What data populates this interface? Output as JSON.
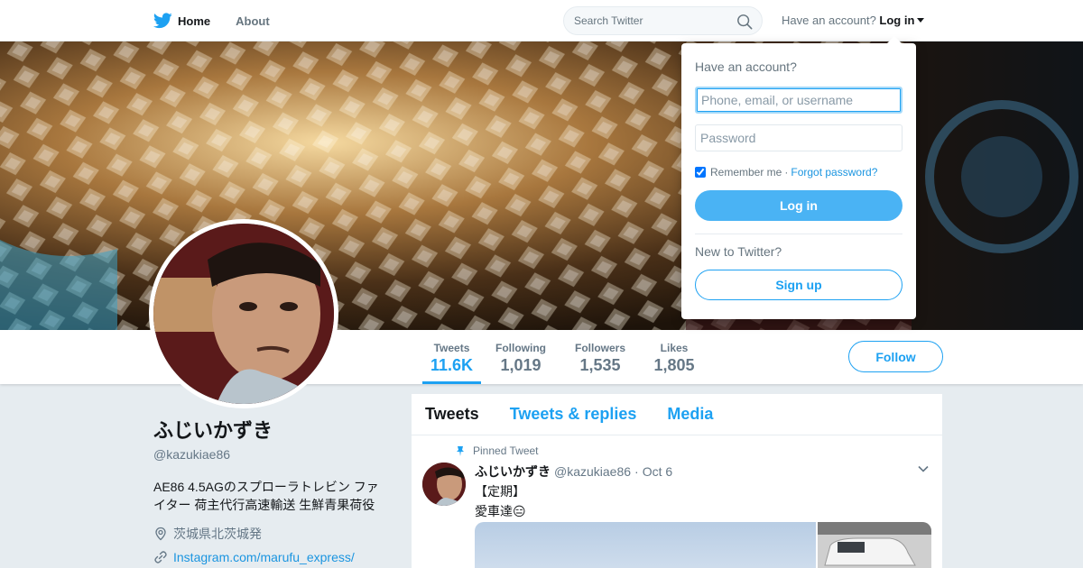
{
  "topbar": {
    "home_label": "Home",
    "about_label": "About",
    "search_placeholder": "Search Twitter",
    "account_prompt": "Have an account?",
    "login_label": "Log in",
    "logo_icon": "twitter-bird-icon",
    "search_icon": "search-icon"
  },
  "profile": {
    "display_name": "ふじいかずき",
    "handle": "@kazukiae86",
    "bio": "AE86 4.5AGのスプローラトレビン ファイター 荷主代行高速輸送 生鮮青果荷役",
    "location": "茨城県北茨城発",
    "website": "Instagram.com/marufu_express/"
  },
  "stats": [
    {
      "label": "Tweets",
      "value": "11.6K"
    },
    {
      "label": "Following",
      "value": "1,019"
    },
    {
      "label": "Followers",
      "value": "1,535"
    },
    {
      "label": "Likes",
      "value": "1,805"
    }
  ],
  "follow_label": "Follow",
  "timeline": {
    "tabs": [
      "Tweets",
      "Tweets & replies",
      "Media"
    ],
    "pinned_label": "Pinned Tweet",
    "tweet": {
      "name": "ふじいかずき",
      "handle": "@kazukiae86",
      "separator": "·",
      "date": "Oct 6",
      "line1": "【定期】",
      "line2": "愛車達😑"
    }
  },
  "login": {
    "title": "Have an account?",
    "username_placeholder": "Phone, email, or username",
    "password_placeholder": "Password",
    "remember": "Remember me",
    "dot": "·",
    "forgot": "Forgot password?",
    "login_button": "Log in",
    "new_label": "New to Twitter?",
    "signup_button": "Sign up"
  },
  "colors": {
    "accent": "#1da1f2",
    "login_button": "#4ab3f4",
    "background": "#e6ecf0"
  }
}
